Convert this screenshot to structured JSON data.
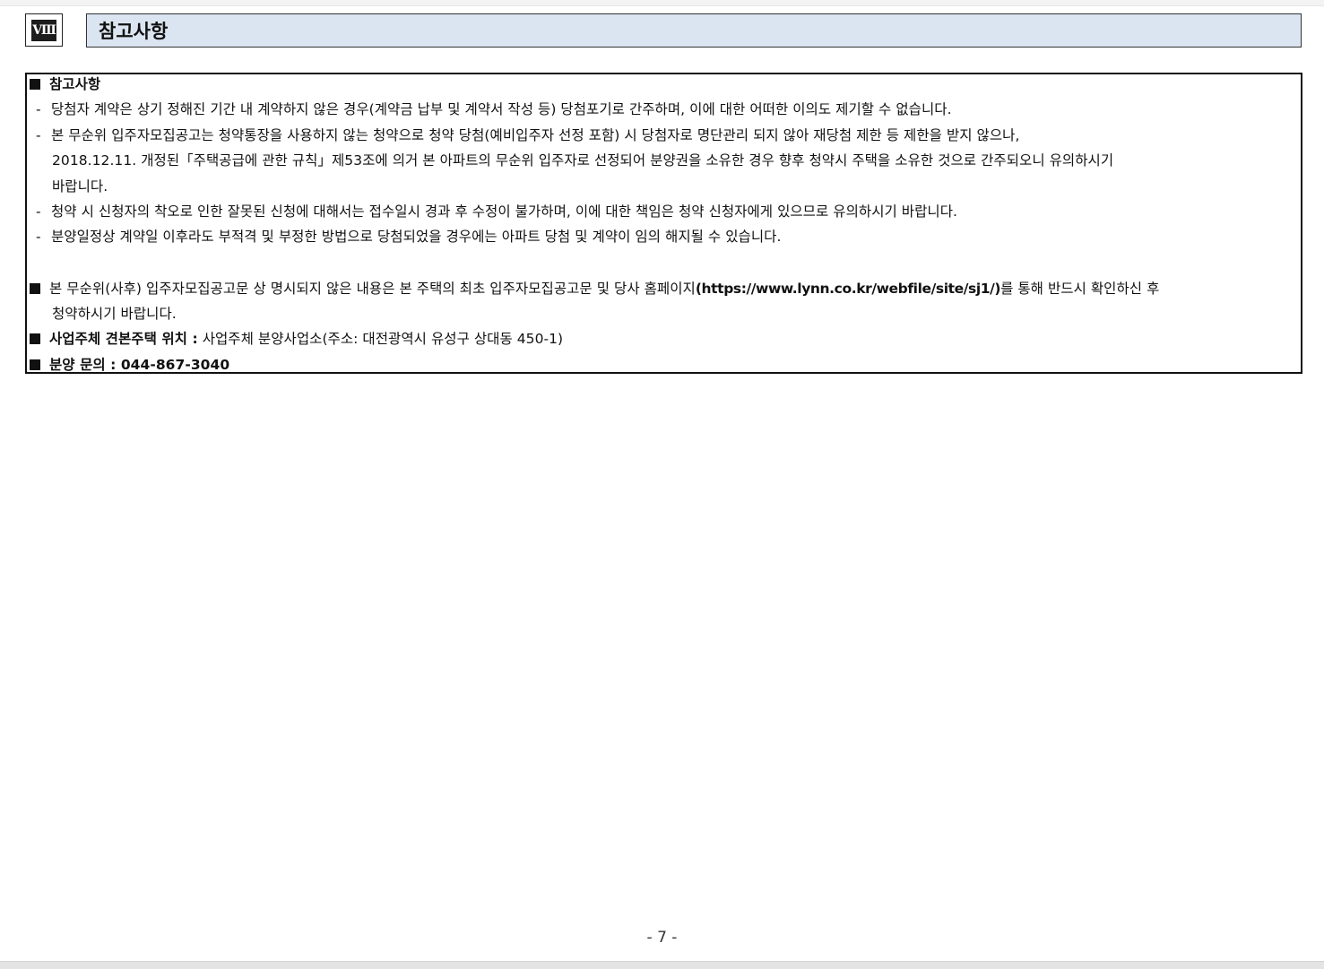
{
  "section": {
    "number": "Ⅷ",
    "title": "참고사항"
  },
  "notes": {
    "heading": "참고사항",
    "items": [
      "당첨자 계약은 상기 정해진 기간 내 계약하지 않은 경우(계약금 납부 및 계약서 작성 등) 당첨포기로 간주하며, 이에 대한 어떠한 이의도 제기할 수 없습니다.",
      "본 무순위 입주자모집공고는 청약통장을 사용하지 않는 청약으로 청약 당첨(예비입주자 선정 포함) 시 당첨자로 명단관리 되지 않아 재당첨 제한 등 제한을 받지 않으나,",
      "2018.12.11. 개정된「주택공급에 관한 규칙」제53조에 의거 본 아파트의 무순위 입주자로 선정되어 분양권을 소유한 경우 향후 청약시 주택을 소유한 것으로 간주되오니 유의하시기",
      "바랍니다.",
      "청약 시 신청자의 착오로 인한 잘못된 신청에 대해서는 접수일시 경과 후 수정이 불가하며, 이에 대한 책임은 청약 신청자에게 있으므로 유의하시기 바랍니다.",
      "분양일정상 계약일 이후라도 부적격 및 부정한 방법으로 당첨되었을 경우에는 아파트 당첨 및 계약이 임의 해지될 수 있습니다."
    ]
  },
  "reference": {
    "text_before": "본 무순위(사후) 입주자모집공고문 상 명시되지 않은 내용은 본 주택의 최초 입주자모집공고문 및 당사 홈페이지",
    "url": "(https://www.lynn.co.kr/webfile/site/sj1/)",
    "text_after": "를 통해 반드시 확인하신 후",
    "continuation": "청약하시기 바랍니다."
  },
  "model_house": {
    "label": "사업주체 견본주택 위치 :",
    "value": "사업주체 분양사업소(주소: 대전광역시 유성구 상대동 450-1)"
  },
  "inquiry": {
    "label": "분양 문의 :",
    "phone": "044-867-3040"
  },
  "page_number": "- 7 -"
}
